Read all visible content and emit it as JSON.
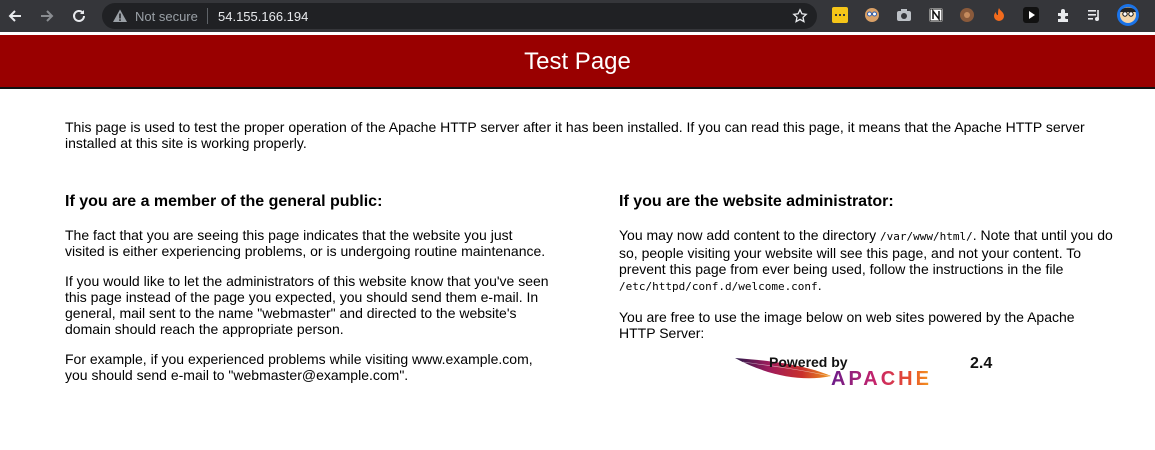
{
  "browser": {
    "security_label": "Not secure",
    "url": "54.155.166.194",
    "icons": [
      "back-icon",
      "forward-icon",
      "reload-icon",
      "warning-icon",
      "star-icon",
      "extensions-icon",
      "media-icon",
      "profile-avatar"
    ]
  },
  "page": {
    "title": "Test Page",
    "intro": "This page is used to test the proper operation of the Apache HTTP server after it has been installed. If you can read this page, it means that the Apache HTTP server installed at this site is working properly.",
    "public": {
      "heading": "If you are a member of the general public:",
      "p1": "The fact that you are seeing this page indicates that the website you just visited is either experiencing problems, or is undergoing routine maintenance.",
      "p2": "If you would like to let the administrators of this website know that you've seen this page instead of the page you expected, you should send them e-mail. In general, mail sent to the name \"webmaster\" and directed to the website's domain should reach the appropriate person.",
      "p3": "For example, if you experienced problems while visiting www.example.com, you should send e-mail to \"webmaster@example.com\"."
    },
    "admin": {
      "heading": "If you are the website administrator:",
      "p1_a": "You may now add content to the directory ",
      "p1_code1": "/var/www/html/",
      "p1_b": ". Note that until you do so, people visiting your website will see this page, and not your content. To prevent this page from ever being used, follow the instructions in the file ",
      "p1_code2": "/etc/httpd/conf.d/welcome.conf",
      "p1_c": ".",
      "p2": "You are free to use the image below on web sites powered by the Apache HTTP Server:"
    },
    "logo": {
      "powered_by": "Powered by",
      "name": "APACHE",
      "version": "2.4"
    }
  },
  "colors": {
    "banner": "#990000",
    "chrome": "#35363a",
    "omnibox": "#202124"
  }
}
